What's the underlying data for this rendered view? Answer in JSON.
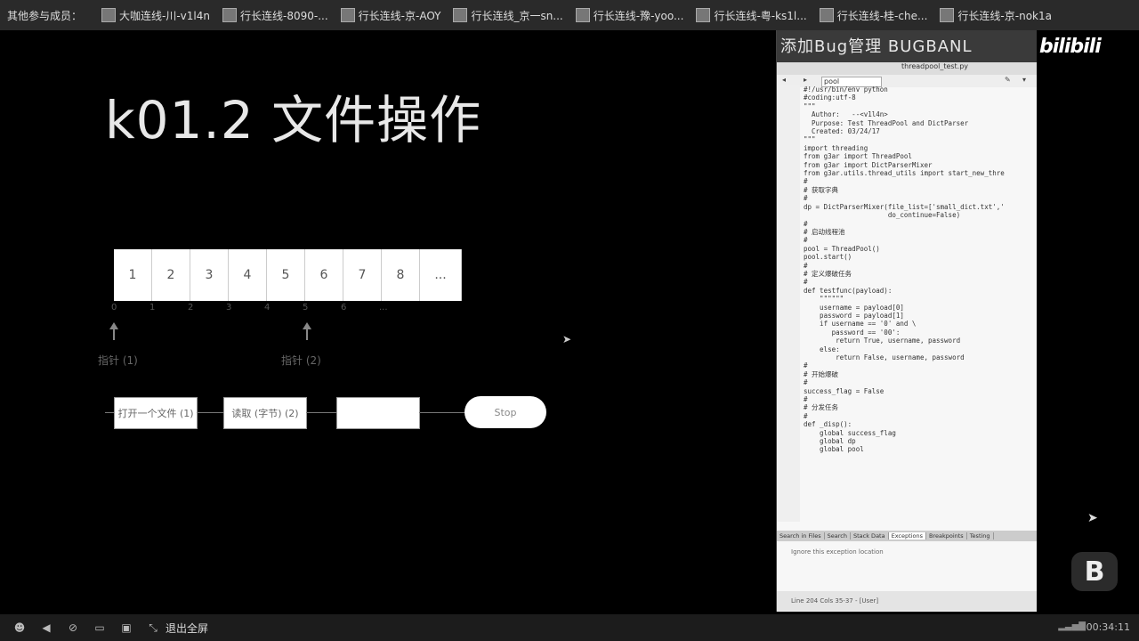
{
  "topbar": {
    "label": "其他参与成员：",
    "members": [
      "大咖连线-川-v1l4n",
      "行长连线-8090-...",
      "行长连线-京-AOY",
      "行长连线_京一sn...",
      "行长连线-豫-yoo...",
      "行长连线-粤-ks1l...",
      "行长连线-桂-che...",
      "行长连线-京-nok1a"
    ]
  },
  "slide": {
    "title": "k01.2 文件操作",
    "cells": [
      "1",
      "2",
      "3",
      "4",
      "5",
      "6",
      "7",
      "8",
      "..."
    ],
    "indices": [
      "0",
      "1",
      "2",
      "3",
      "4",
      "5",
      "6",
      "..."
    ],
    "pointer1": "指针 (1)",
    "pointer2": "指针 (2)",
    "flow": [
      "打开一个文件 (1)",
      "读取 (字节) (2)",
      ""
    ],
    "stop": "Stop"
  },
  "ide": {
    "title": "添加Bug管理 BUGBANL",
    "tabs": "threadpool_test.py",
    "search": "pool",
    "code": [
      "#!/usr/bin/env python",
      "#coding:utf-8",
      "\"\"\"",
      "  Author:   --<v1l4n>",
      "  Purpose: Test ThreadPool and DictParser",
      "  Created: 03/24/17",
      "\"\"\"",
      "",
      "import threading",
      "",
      "from g3ar import ThreadPool",
      "from g3ar import DictParserMixer",
      "from g3ar.utils.thread_utils import start_new_thre",
      "",
      "#",
      "# 获取字典",
      "#",
      "dp = DictParserMixer(file_list=['small_dict.txt','",
      "                     do_continue=False)",
      "",
      "#",
      "# 启动线程池",
      "#",
      "pool = ThreadPool()",
      "pool.start()",
      "",
      "#",
      "# 定义爆破任务",
      "#",
      "def testfunc(payload):",
      "    \"\"\"\"\"\"",
      "    username = payload[0]",
      "    password = payload[1]",
      "",
      "    if username == '0' and \\",
      "       password == '00':",
      "        return True, username, password",
      "    else:",
      "        return False, username, password",
      "",
      "#",
      "# 开始爆破",
      "#",
      "success_flag = False",
      "",
      "#",
      "# 分发任务",
      "#",
      "def _disp():",
      "    global success_flag",
      "    global dp",
      "    global pool"
    ],
    "bottom_tabs": [
      "Search in Files",
      "Search",
      "Stack Data",
      "Exceptions",
      "Breakpoints",
      "Testing"
    ],
    "active_tab": "Exceptions",
    "exceptions_text": "Ignore this exception location",
    "status": "Line 204 Cols 35-37 - [User]"
  },
  "watermark": "bilibili",
  "bottombar": {
    "exit_fullscreen": "退出全屏",
    "clock": "00:34:11"
  }
}
